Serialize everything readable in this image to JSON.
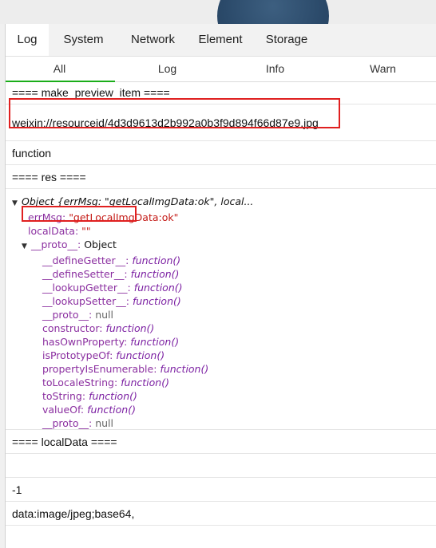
{
  "tabs": [
    "Log",
    "System",
    "Network",
    "Element",
    "Storage"
  ],
  "active_tab": "Log",
  "subtabs": [
    "All",
    "Log",
    "Info",
    "Warn"
  ],
  "active_subtab": "All",
  "logs": {
    "line1": "==== make_preview_item ====",
    "line2": "weixin://resourceid/4d3d9613d2b992a0b3f9d894f66d87e9.jpg",
    "line3": "function",
    "line4": "==== res ====",
    "obj_header": "Object {errMsg: \"getLocalImgData:ok\", local...",
    "errMsg_key": "errMsg:",
    "errMsg_val": "\"getLocalImgData:ok\"",
    "localData_key": "localData:",
    "localData_val": "\"\"",
    "proto_key": "__proto__:",
    "proto_val": "Object",
    "proto_items": [
      {
        "key": "__defineGetter__:",
        "val": "function()"
      },
      {
        "key": "__defineSetter__:",
        "val": "function()"
      },
      {
        "key": "__lookupGetter__:",
        "val": "function()"
      },
      {
        "key": "__lookupSetter__:",
        "val": "function()"
      },
      {
        "key": "__proto__:",
        "val": "null"
      },
      {
        "key": "constructor:",
        "val": "function()"
      },
      {
        "key": "hasOwnProperty:",
        "val": "function()"
      },
      {
        "key": "isPrototypeOf:",
        "val": "function()"
      },
      {
        "key": "propertyIsEnumerable:",
        "val": "function()"
      },
      {
        "key": "toLocaleString:",
        "val": "function()"
      },
      {
        "key": "toString:",
        "val": "function()"
      },
      {
        "key": "valueOf:",
        "val": "function()"
      },
      {
        "key": "__proto__:",
        "val": "null"
      }
    ],
    "line5": "==== localData ====",
    "line6": "",
    "line7": "-1",
    "line8": "data:image/jpeg;base64,"
  },
  "colors": {
    "highlight": "#e02020",
    "accent": "#1aad19"
  }
}
